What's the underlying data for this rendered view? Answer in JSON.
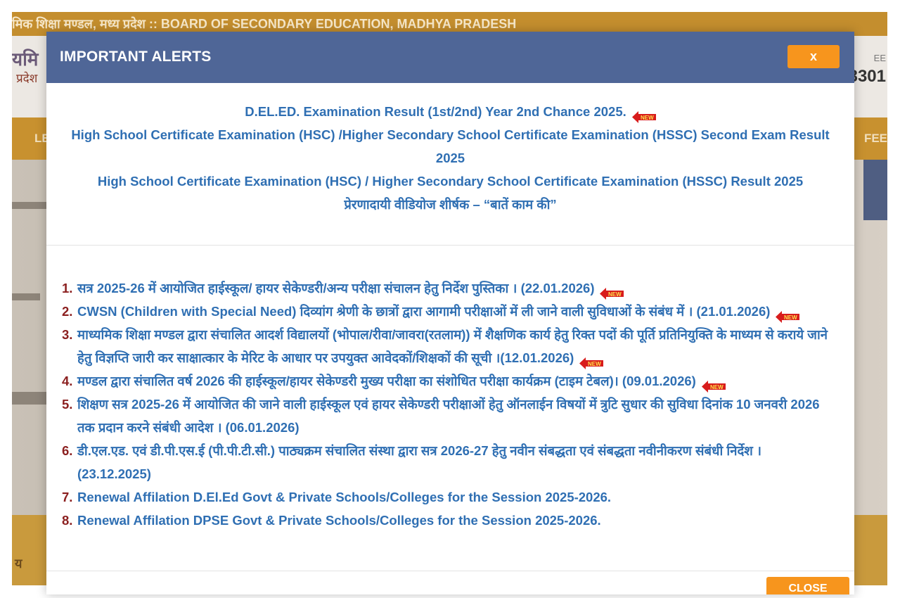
{
  "background": {
    "topbar_text": "मिक शिक्षा मण्डल, मध्य प्रदेश :: BOARD OF SECONDARY EDUCATION, MADHYA PRADESH",
    "logo_text_a": "यमि",
    "logo_text_b": "प्रदेश",
    "right_text_a": "EE",
    "right_text_b": "3301",
    "nav_left": "LE",
    "nav_right": "FEE",
    "footer_text": "य"
  },
  "modal": {
    "title": "IMPORTANT ALERTS",
    "close_label": "x",
    "footer_close_label": "CLOSE",
    "new_badge_text": "NEW",
    "top_links": [
      {
        "text": "D.EL.ED. Examination Result (1st/2nd) Year 2nd Chance 2025.",
        "is_new": true
      },
      {
        "text": "High School Certificate Examination (HSC) /Higher Secondary School Certificate Examination (HSSC) Second Exam Result 2025",
        "is_new": false
      },
      {
        "text": "High School Certificate Examination (HSC) / Higher Secondary School Certificate Examination (HSSC) Result 2025",
        "is_new": false
      },
      {
        "text": "प्रेरणादायी वीडियोज शीर्षक – “बातें काम की”",
        "is_new": false
      }
    ],
    "alerts": [
      {
        "num": "1.",
        "text": "सत्र 2025-26 में आयोजित हाईस्कूल/ हायर सेकेण्डरी/अन्य परीक्षा संचालन हेतु निर्देश पुस्तिका । (22.01.2026)",
        "is_new": true
      },
      {
        "num": "2.",
        "text": "CWSN (Children with Special Need) दिव्यांग श्रेणी के छात्रों द्वारा आगामी परीक्षाओं में ली जाने वाली सुविधाओं के संबंध में । (21.01.2026)",
        "is_new": true
      },
      {
        "num": "3.",
        "text": "माध्यमिक शिक्षा मण्डल द्वारा संचालित आदर्श विद्यालयों (भोपाल/रीवा/जावरा(रतलाम)) में शैक्षणिक कार्य हेतु रिक्त पदों की पूर्ति प्रतिनियुक्ति के माध्यम से कराये जाने हेतु विज्ञप्ति जारी कर साक्षात्कार के मेरिट के आधार पर उपयुक्त आवेदकों/शिक्षकों की सूची ।(12.01.2026)",
        "is_new": true
      },
      {
        "num": "4.",
        "text": "मण्डल द्वारा संचालित वर्ष 2026 की हाईस्कूल/हायर सेकेण्डरी मुख्य परीक्षा का संशोधित परीक्षा कार्यक्रम (टाइम टेबल)। (09.01.2026)",
        "is_new": true
      },
      {
        "num": "5.",
        "text": "शिक्षण सत्र 2025-26 में आयोजित की जाने वाली हाईस्कूल एवं हायर सेकेण्डरी परीक्षाओं हेतु ऑनलाईन विषयों में त्रुटि सुधार की सुविधा दिनांक 10 जनवरी 2026 तक प्रदान करने संबंधी आदेश । (06.01.2026)",
        "is_new": false
      },
      {
        "num": "6.",
        "text": "डी.एल.एड. एवं डी.पी.एस.ई (पी.पी.टी.सी.) पाठ्यक्रम संचालित संस्था द्वारा सत्र 2026-27 हेतु नवीन संबद्धता एवं संबद्धता नवीनीकरण संबंधी निर्देश । (23.12.2025)",
        "is_new": false
      },
      {
        "num": "7.",
        "text": "Renewal Affilation D.El.Ed Govt & Private Schools/Colleges for the Session 2025-2026.",
        "is_new": false
      },
      {
        "num": "8.",
        "text": "Renewal Affilation DPSE Govt & Private Schools/Colleges for the Session 2025-2026.",
        "is_new": false
      }
    ]
  },
  "colors": {
    "modal_header": "#4f6697",
    "link": "#2f6fb3",
    "number": "#8b1f1f",
    "close_button": "#f7951d"
  }
}
